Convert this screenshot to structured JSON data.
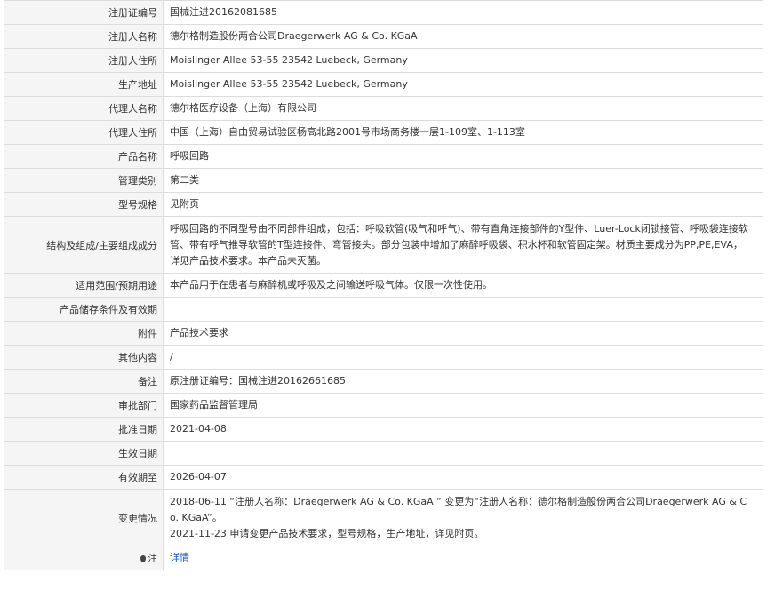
{
  "rows": [
    {
      "label": "注册证编号",
      "value": "国械注进20162081685"
    },
    {
      "label": "注册人名称",
      "value": "德尔格制造股份两合公司Draegerwerk AG & Co. KGaA"
    },
    {
      "label": "注册人住所",
      "value": "Moislinger Allee 53-55 23542 Luebeck, Germany"
    },
    {
      "label": "生产地址",
      "value": "Moislinger Allee 53-55 23542 Luebeck, Germany"
    },
    {
      "label": "代理人名称",
      "value": "德尔格医疗设备（上海）有限公司"
    },
    {
      "label": "代理人住所",
      "value": "中国（上海）自由贸易试验区杨高北路2001号市场商务楼一层1-109室、1-113室"
    },
    {
      "label": "产品名称",
      "value": "呼吸回路"
    },
    {
      "label": "管理类别",
      "value": "第二类"
    },
    {
      "label": "型号规格",
      "value": "见附页"
    },
    {
      "label": "结构及组成/主要组成成分",
      "lines": [
        "呼吸回路的不同型号由不同部件组成，包括：呼吸软管(吸气和呼气)、带有直角连接部件的Y型件、Luer-Lock闭锁接管、呼吸袋连接软",
        "管、带有呼气推导软管的T型连接件、弯管接头。部分包装中增加了麻醉呼吸袋、积水杯和软管固定架。材质主要成分为PP,PE,EVA，",
        "详见产品技术要求。本产品未灭菌。"
      ]
    },
    {
      "label": "适用范围/预期用途",
      "value": "本产品用于在患者与麻醉机或呼吸及之间输送呼吸气体。仅限一次性使用。"
    },
    {
      "label": "产品储存条件及有效期",
      "value": ""
    },
    {
      "label": "附件",
      "value": "产品技术要求"
    },
    {
      "label": "其他内容",
      "value": "/"
    },
    {
      "label": "备注",
      "value": "原注册证编号：国械注进20162661685"
    },
    {
      "label": "审批部门",
      "value": "国家药品监督管理局"
    },
    {
      "label": "批准日期",
      "value": "2021-04-08"
    },
    {
      "label": "生效日期",
      "value": ""
    },
    {
      "label": "有效期至",
      "value": "2026-04-07"
    },
    {
      "label": "变更情况",
      "lines": [
        "2018-06-11 “注册人名称：Draegerwerk AG & Co. KGaA ” 变更为“注册人名称：德尔格制造股份两合公司Draegerwerk AG & C",
        "o. KGaA”。",
        "2021-11-23 申请变更产品技术要求，型号规格，生产地址，详见附页。"
      ]
    }
  ],
  "note": {
    "label": "注",
    "icon": "location-pin-icon",
    "link_text": "详情",
    "link_color": "#1a56b8"
  },
  "colors": {
    "label_bg": "#f5f5f5",
    "border": "#dcdcdc",
    "text": "#333333"
  }
}
